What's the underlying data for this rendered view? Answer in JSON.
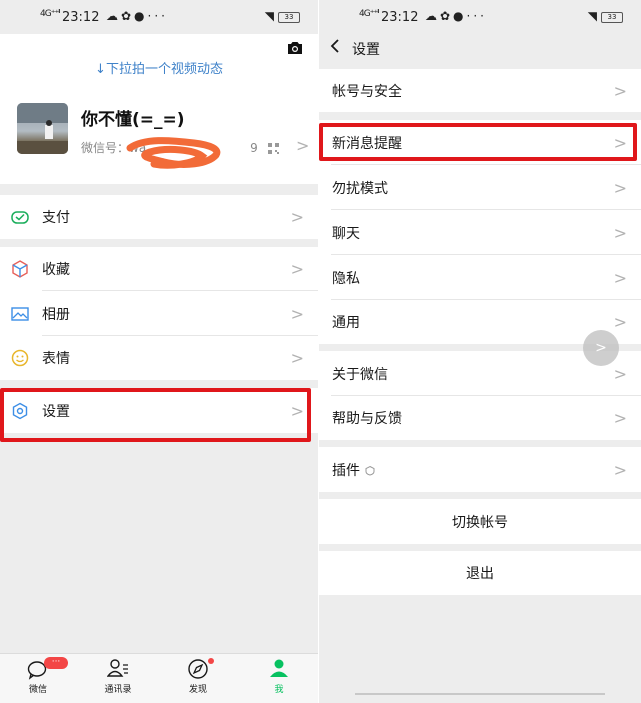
{
  "status": {
    "signal": "4G⁺⁺ᴵᴵ",
    "time": "23:12",
    "battery": "33"
  },
  "me": {
    "pull_hint": "↓下拉拍一个视频动态",
    "nickname": "你不懂(=_=)",
    "wechat_id_label": "微信号：wa",
    "wechat_id_tail": "9",
    "menu": [
      {
        "label": "支付",
        "icon": "pay-icon"
      },
      {
        "label": "收藏",
        "icon": "favorites-icon"
      },
      {
        "label": "相册",
        "icon": "album-icon"
      },
      {
        "label": "表情",
        "icon": "sticker-icon"
      },
      {
        "label": "设置",
        "icon": "settings-icon"
      }
    ],
    "tabs": [
      {
        "label": "微信",
        "icon": "chats-icon"
      },
      {
        "label": "通讯录",
        "icon": "contacts-icon"
      },
      {
        "label": "发现",
        "icon": "discover-icon"
      },
      {
        "label": "我",
        "icon": "me-icon",
        "active": true
      }
    ]
  },
  "settings": {
    "title": "设置",
    "items": [
      "帐号与安全",
      "新消息提醒",
      "勿扰模式",
      "聊天",
      "隐私",
      "通用",
      "关于微信",
      "帮助与反馈",
      "插件"
    ],
    "switch_account": "切换帐号",
    "logout": "退出"
  },
  "colors": {
    "accent": "#07c160",
    "highlight": "#e0171b",
    "link": "#576b95"
  }
}
